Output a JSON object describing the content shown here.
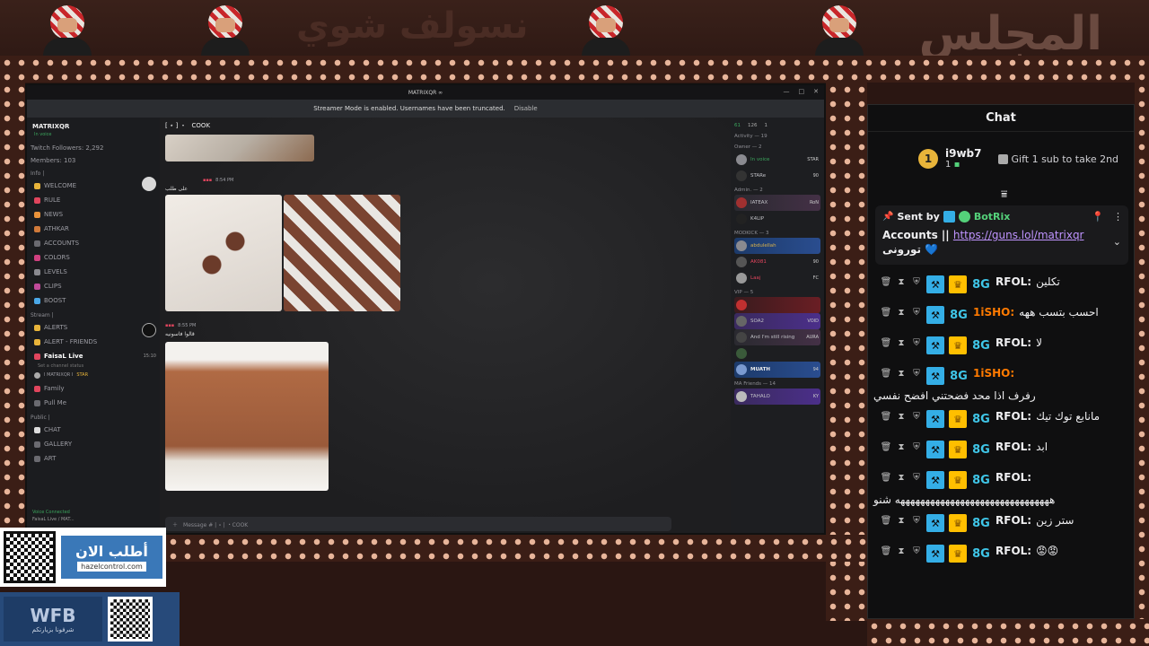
{
  "banner": {
    "title_right": "المجلس",
    "title_left": "نسولف شوي"
  },
  "window": {
    "title": "MATRIXQR ∞",
    "streamer_notice": "Streamer Mode is enabled. Usernames have been truncated.",
    "disable_label": "Disable"
  },
  "discord": {
    "server_name": "MATRIXQR",
    "server_status": "In voice",
    "twitch_followers": "Twitch Followers: 2,292",
    "members": "Members: 103",
    "categories": {
      "info": "Info |",
      "stream": "Stream |",
      "public": "Public |"
    },
    "info_channels": [
      "WELCOME",
      "RULE",
      "NEWS",
      "ATHKAR",
      "ACCOUNTS",
      "COLORS",
      "LEVELS",
      "CLIPS",
      "BOOST"
    ],
    "stream_channels": [
      "ALERTS",
      "ALERT - FRIENDS",
      "FaisaL Live"
    ],
    "live_time": "15:10",
    "channel_status_placeholder": "Set a channel status",
    "voice_user": "I MATRIXQR I",
    "star_label": "STAR",
    "extra_channels": [
      "Family",
      "Pull Me"
    ],
    "public_channels": [
      "CHAT",
      "GALLERY",
      "ART"
    ],
    "voice_connected": "Voice Connected",
    "voice_connected_sub": "FaisaL Live / MAT...",
    "current_channel": "COOK",
    "message_placeholder": "Message # | ⋆ | ・COOK",
    "msg1_time": "8:54 PM",
    "msg1_text": "على طلب",
    "msg2_time": "8:55 PM",
    "msg2_text": "قالوا فاسونيه",
    "member_stats": {
      "online": "61",
      "total": "126",
      "other": "1"
    },
    "member_groups": {
      "activity": "Activity — 19",
      "owner": "Owner — 2",
      "admin": "Admin. — 2",
      "modkick": "MODKICK — 3",
      "vip": "VIP — 5",
      "friends": "MA Friends — 14"
    },
    "members_list": [
      {
        "name": "",
        "sub": "In voice",
        "badge": "STAR"
      },
      {
        "name": "",
        "sub": "STARe",
        "badge": "90"
      },
      {
        "name": "IATEAX",
        "sub": "",
        "badge": "RoN"
      },
      {
        "name": "",
        "sub": "K4LIP",
        "badge": ""
      },
      {
        "name": "abdulellah",
        "sub": "",
        "badge": ""
      },
      {
        "name": "AK081",
        "sub": "Kick AK4O1",
        "badge": "90"
      },
      {
        "name": "Laaj",
        "sub": "",
        "badge": "FC"
      },
      {
        "name": "",
        "sub": "",
        "badge": ""
      },
      {
        "name": "",
        "sub": "SOA2",
        "badge": "VOID"
      },
      {
        "name": "",
        "sub": "And I'm still rising",
        "badge": "AURA"
      },
      {
        "name": "",
        "sub": "",
        "badge": ""
      },
      {
        "name": "MUATH",
        "sub": "MUATH94",
        "badge": "94"
      },
      {
        "name": "TAHALO",
        "sub": "",
        "badge": "KY"
      }
    ]
  },
  "chat": {
    "title": "Chat",
    "leader": {
      "rank": "1",
      "name": "i9wb7",
      "count": "1"
    },
    "gift_text": "Gift 1 sub to take 2nd",
    "pinned": {
      "sent_by_label": "Sent by",
      "bot_name": "BotRix",
      "accounts_label": "Accounts ||",
      "link": "https://guns.lol/matrixqr",
      "extra": "تورونی 💙"
    },
    "messages": [
      {
        "user": "RFOL:",
        "text": "تكلين",
        "color": "#efeff1",
        "vip": true
      },
      {
        "user": "1iSHO:",
        "text": "احسب بتسب ههه",
        "color": "#ff7a00",
        "vip": false
      },
      {
        "user": "RFOL:",
        "text": "لا",
        "color": "#efeff1",
        "vip": true
      },
      {
        "user": "1iSHO:",
        "text": "رفرف اذا محد فضحتني افضح نفسي",
        "color": "#ff7a00",
        "vip": false
      },
      {
        "user": "RFOL:",
        "text": "مانابع توك تيك",
        "color": "#efeff1",
        "vip": true
      },
      {
        "user": "RFOL:",
        "text": "ابد",
        "color": "#efeff1",
        "vip": true
      },
      {
        "user": "RFOL:",
        "text": "هههههههههههههههههههههههههههههههه شنو",
        "color": "#efeff1",
        "vip": true
      },
      {
        "user": "RFOL:",
        "text": "ستر زين",
        "color": "#efeff1",
        "vip": true
      },
      {
        "user": "RFOL:",
        "text": "😡😡",
        "color": "#efeff1",
        "vip": true
      }
    ]
  },
  "ads": {
    "order_title": "أطلب الان",
    "order_url": "hazelcontrol.com",
    "wfb_title": "WFB",
    "wfb_sub": "شرفونا بزيارتكم"
  },
  "colors": {
    "frame_dark": "#2a1612",
    "frame_dots": "#e8b59a",
    "mod_badge": "#34aee6",
    "vip_badge": "#ffbf00",
    "bot_green": "#54d17a",
    "link": "#bf94ff"
  }
}
